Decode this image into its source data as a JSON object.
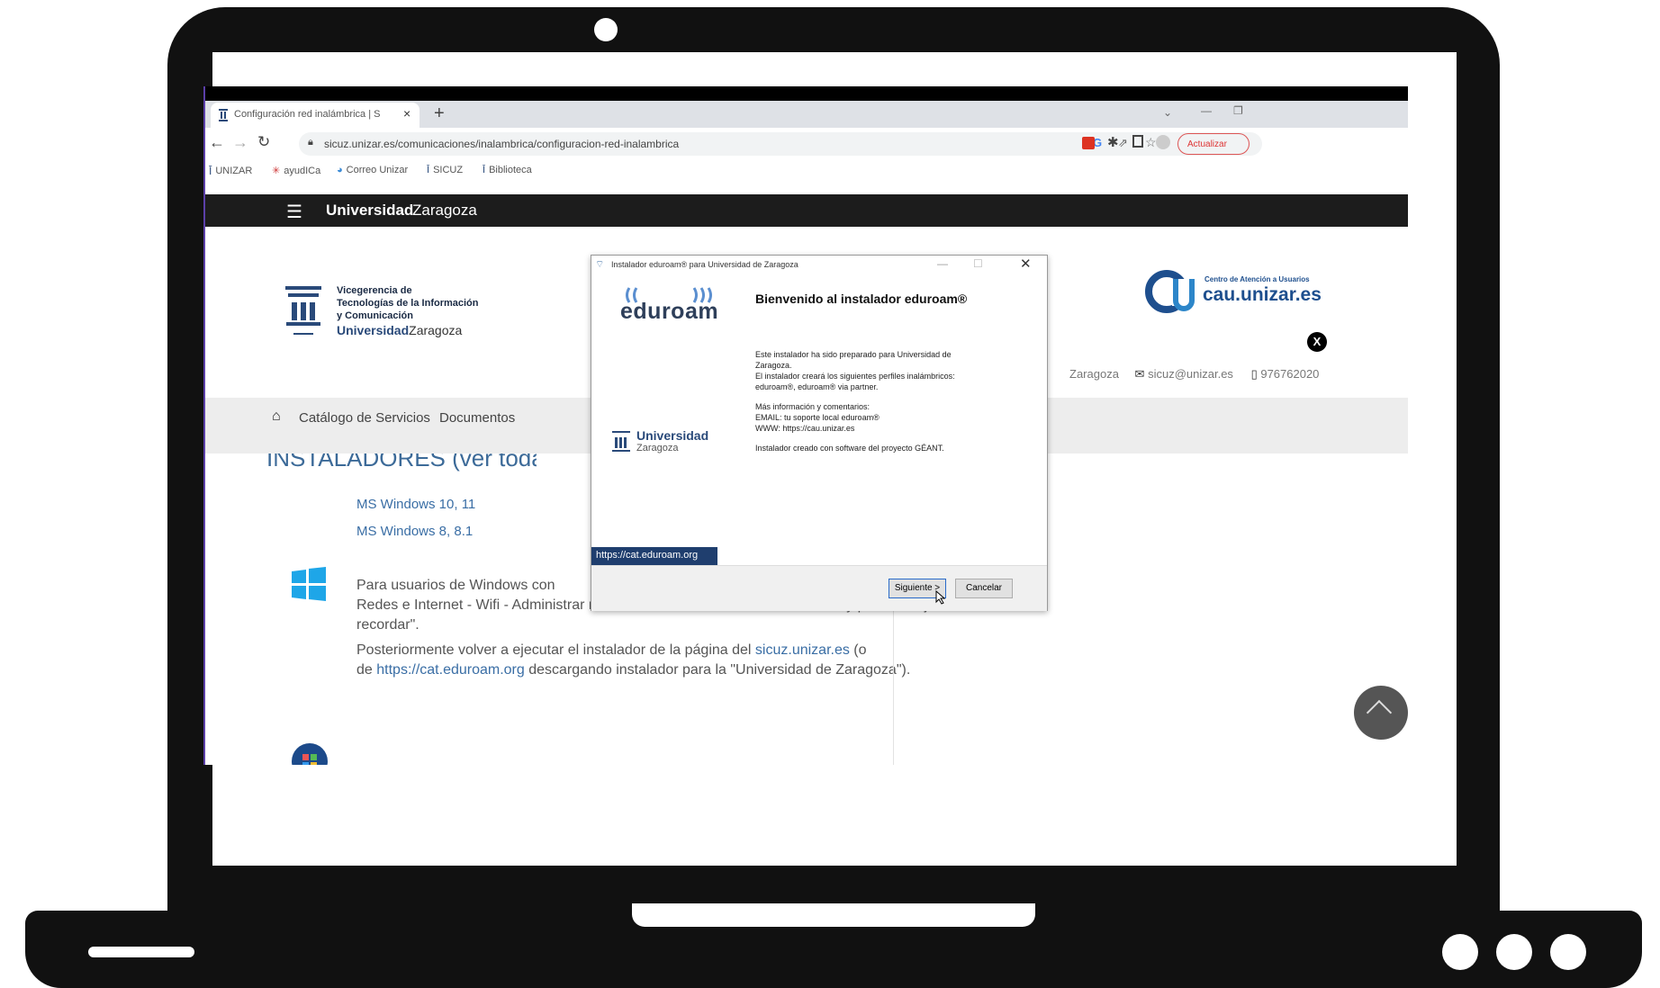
{
  "browser": {
    "tab_title": "Configuración red inalámbrica | S",
    "tab_close": "×",
    "new_tab": "+",
    "url": "sicuz.unizar.es/comunicaciones/inalambrica/configuracion-red-inalambrica",
    "update_button": "Actualizar",
    "bookmarks": [
      "UNIZAR",
      "ayudICa",
      "Correo Unizar",
      "SICUZ",
      "Biblioteca"
    ]
  },
  "site": {
    "brand_bold": "Universidad",
    "brand_rest": "Zaragoza",
    "org_line1": "Vicegerencia de",
    "org_line2": "Tecnologías de la Información",
    "org_line3": "y Comunicación",
    "org_brand_bold": "Universidad",
    "org_brand_rest": "Zaragoza",
    "cau_small": "Centro de Atención a Usuarios",
    "cau_big": "cau.unizar.es",
    "contact_city": "Zaragoza",
    "contact_email": "sicuz@unizar.es",
    "contact_phone": "976762020",
    "nav": [
      "Catálogo de Servicios",
      "Documentos"
    ],
    "section_heading": "INSTALADORES (ver todas",
    "installer_links": [
      "MS Windows 10, 11",
      "MS Windows 8, 8.1"
    ],
    "para1_line1": "Para usuarios de Windows con",
    "para1_line2": "Redes e Internet - Wifi - Administrar redes conocidas - Seleccionar eduroam y pulsar \"Dejar de",
    "para1_line3": "recordar\".",
    "para2_pre": "Posteriormente volver a ejecutar el instalador de la página del ",
    "para2_link1": "sicuz.unizar.es",
    "para2_mid": " (o",
    "para2_de": "de ",
    "para2_link2": "https://cat.eduroam.org",
    "para2_post": " descargando instalador para la \"Universidad de Zaragoza\")."
  },
  "dialog": {
    "title": "Instalador eduroam® para Universidad de Zaragoza",
    "eduroam_logo": "eduroam",
    "welcome": "Bienvenido al instalador eduroam®",
    "body1": "Este instalador ha sido preparado para Universidad de Zaragoza.",
    "body2": "El instalador creará los siguientes perfiles inalámbricos: eduroam®, eduroam® via partner.",
    "body3": "Más información y comentarios:",
    "body4": "EMAIL: tu soporte local eduroam®",
    "body5": "WWW: https://cau.unizar.es",
    "body6": "Instalador creado con software del proyecto GÉANT.",
    "uni_bold": "Universidad",
    "uni_rest": "Zaragoza",
    "cat_link": "https://cat.eduroam.org",
    "next_button": "Siguiente >",
    "cancel_button": "Cancelar"
  },
  "colors": {
    "site_header": "#1c1c1c",
    "link_blue": "#3a6ea5",
    "dialog_blue_bar": "#1f3e6e",
    "laptop": "#111111"
  }
}
